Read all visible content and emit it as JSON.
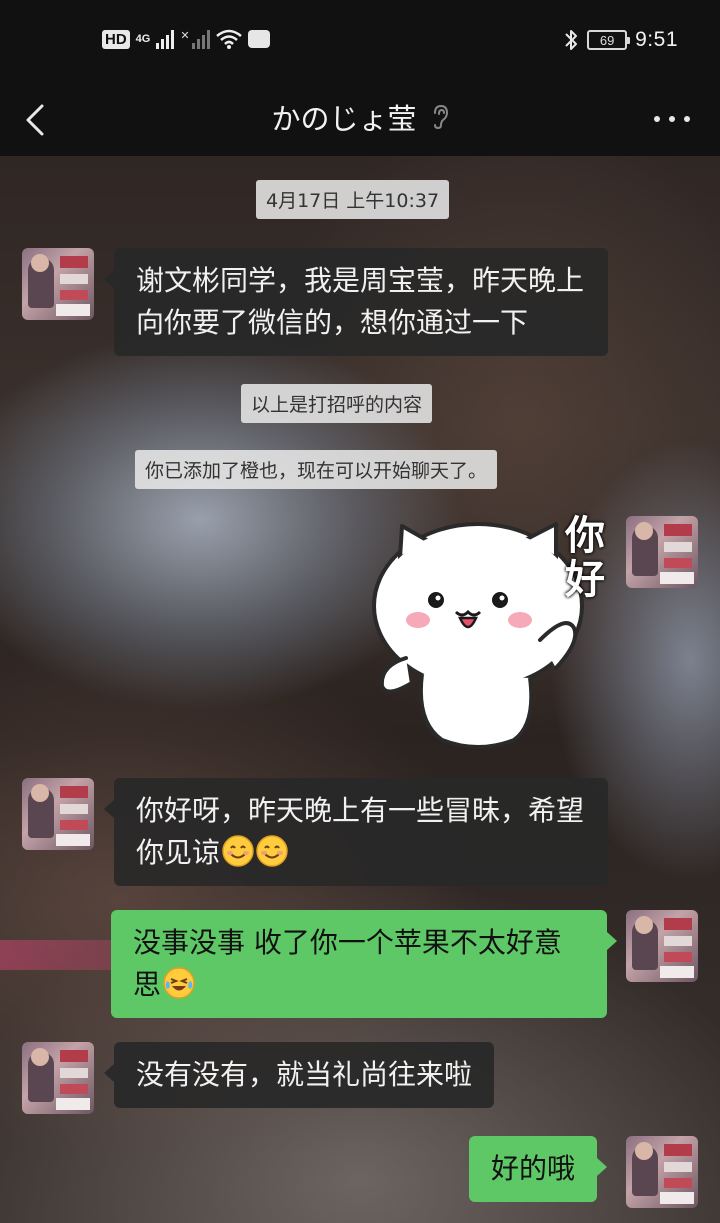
{
  "status_bar": {
    "hd": "HD",
    "network": "4G",
    "battery": "69",
    "time": "9:51"
  },
  "header": {
    "title": "かのじょ莹"
  },
  "messages": {
    "timestamp": "4月17日 上午10:37",
    "m1": "谢文彬同学，我是周宝莹，昨天晚上向你要了微信的，想你通过一下",
    "system1": "以上是打招呼的内容",
    "system2": "你已添加了橙也，现在可以开始聊天了。",
    "sticker_text": "你好",
    "m2": "你好呀，昨天晚上有一些冒昧，希望你见谅",
    "m3": "没事没事 收了你一个苹果不太好意思",
    "m4": "没有没有，就当礼尚往来啦",
    "m5": "好的哦"
  },
  "colors": {
    "outgoing_bubble": "#5fc866",
    "incoming_bubble": "#282828",
    "bar_background": "#111111"
  },
  "icons": [
    "back-arrow-icon",
    "ear-icon",
    "more-icon",
    "bluetooth-icon",
    "wifi-icon",
    "signal-icon",
    "smile-emoji",
    "laugh-cry-emoji",
    "white-cat-sticker"
  ]
}
